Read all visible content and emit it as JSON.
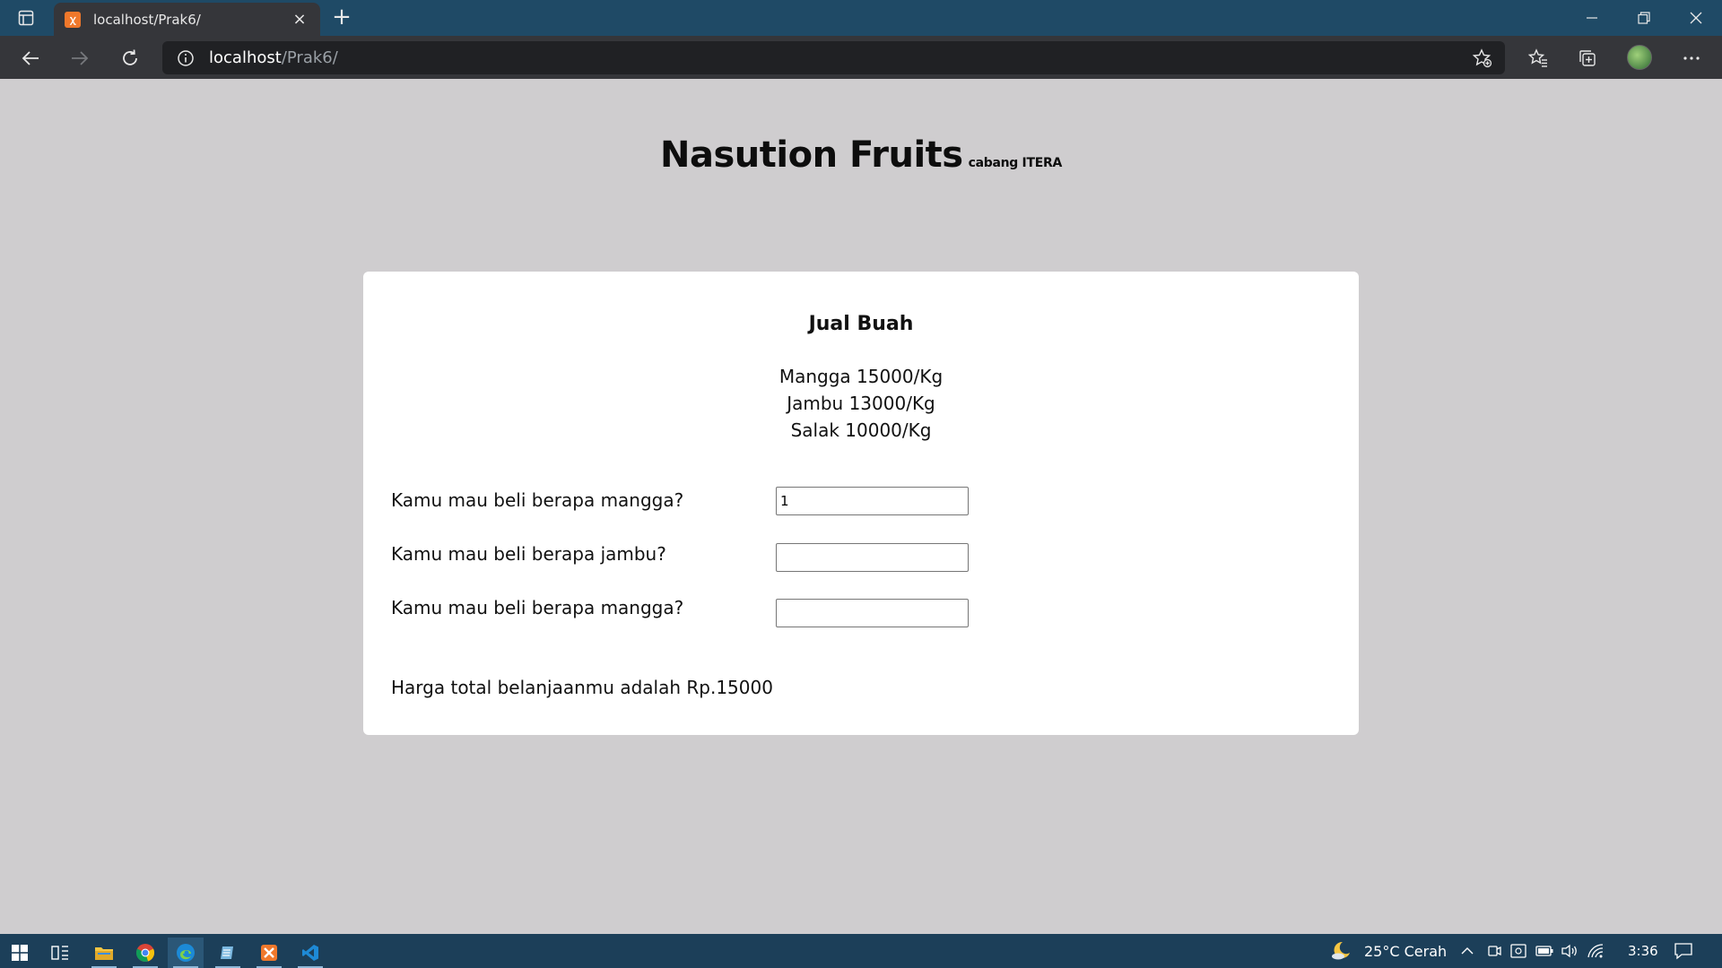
{
  "browser": {
    "tab_title": "localhost/Prak6/",
    "tab_close": "×",
    "new_tab": "+",
    "url_host": "localhost",
    "url_path": "/Prak6/"
  },
  "page": {
    "title": "Nasution Fruits",
    "subtitle": "cabang ITERA",
    "card_title": "Jual Buah",
    "prices": [
      "Mangga 15000/Kg",
      "Jambu 13000/Kg",
      "Salak 10000/Kg"
    ],
    "form": {
      "rows": [
        {
          "label": "Kamu mau beli berapa mangga?",
          "value": "1"
        },
        {
          "label": "Kamu mau beli berapa jambu?",
          "value": ""
        },
        {
          "label": "Kamu mau beli berapa mangga?",
          "value": ""
        }
      ]
    },
    "total_text": "Harga total belanjaanmu adalah Rp.15000"
  },
  "taskbar": {
    "weather": "25°C Cerah",
    "time": "3:36"
  },
  "colors": {
    "tab_bar": "#1f4a66",
    "toolbar": "#35363a",
    "page_bg": "#cfcdcf",
    "card_bg": "#ffffff",
    "taskbar": "#1c3f59"
  }
}
